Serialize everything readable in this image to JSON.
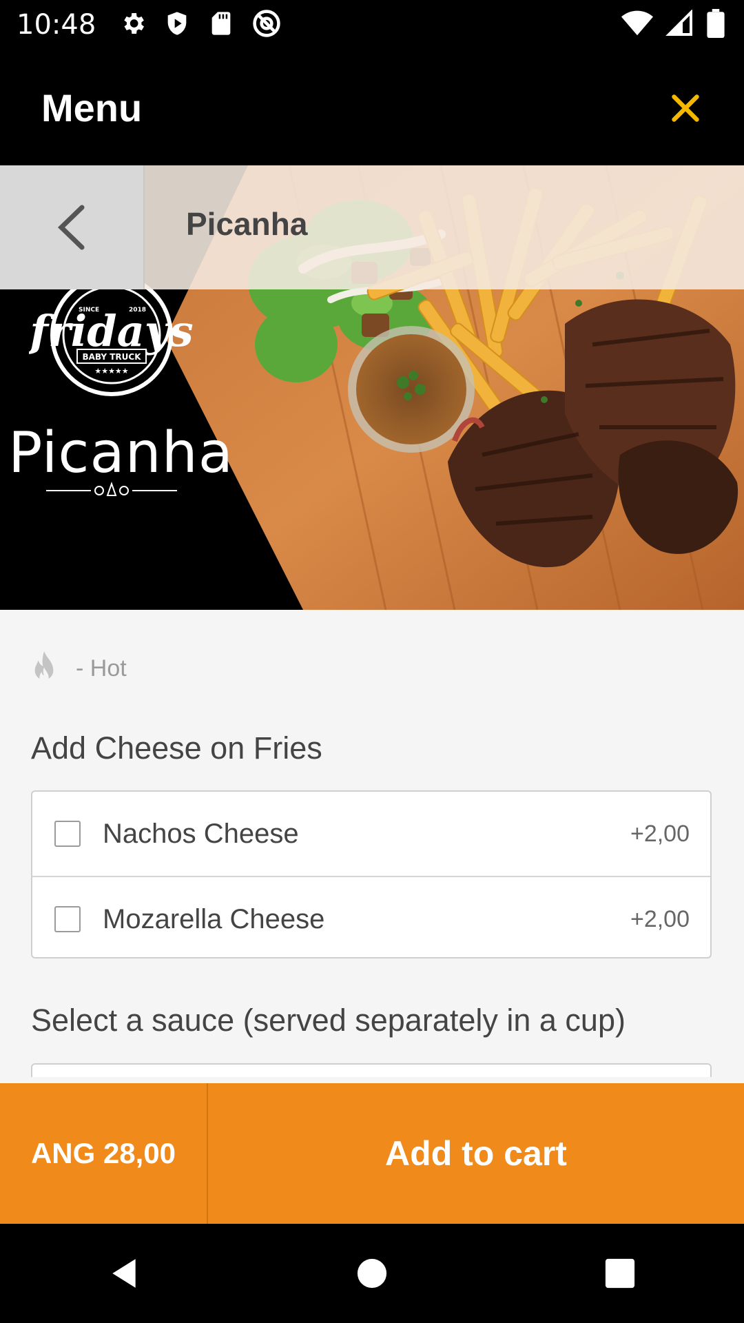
{
  "status_bar": {
    "time": "10:48",
    "left_icons": [
      "gear-icon",
      "shield-icon",
      "sd-card-icon",
      "at-sign-icon"
    ],
    "right_icons": [
      "wifi-icon",
      "signal-icon",
      "battery-icon"
    ]
  },
  "app_bar": {
    "title": "Menu",
    "close_icon": "close-icon",
    "accent_color": "#f5b800"
  },
  "sub_header": {
    "back_icon": "chevron-left-icon",
    "title": "Picanha"
  },
  "hero": {
    "logo_top_left": "SINCE",
    "logo_top_right": "2018",
    "logo_script": "fridays",
    "logo_banner": "BABY TRUCK",
    "logo_stars": "★★★★★",
    "title": "Picanha"
  },
  "content": {
    "hot_icon": "flame-icon",
    "hot_label": "- Hot",
    "cheese_section": {
      "title": "Add Cheese on Fries",
      "options": [
        {
          "label": "Nachos Cheese",
          "price": "+2,00",
          "checked": false
        },
        {
          "label": "Mozarella Cheese",
          "price": "+2,00",
          "checked": false
        }
      ]
    },
    "sauce_section": {
      "title": "Select a sauce (served separately in a cup)"
    }
  },
  "bottom_bar": {
    "total": "ANG 28,00",
    "add_to_cart": "Add to cart",
    "color": "#ef8a1b"
  },
  "nav_bar": {
    "icons": [
      "back-triangle-icon",
      "home-circle-icon",
      "recents-square-icon"
    ]
  }
}
